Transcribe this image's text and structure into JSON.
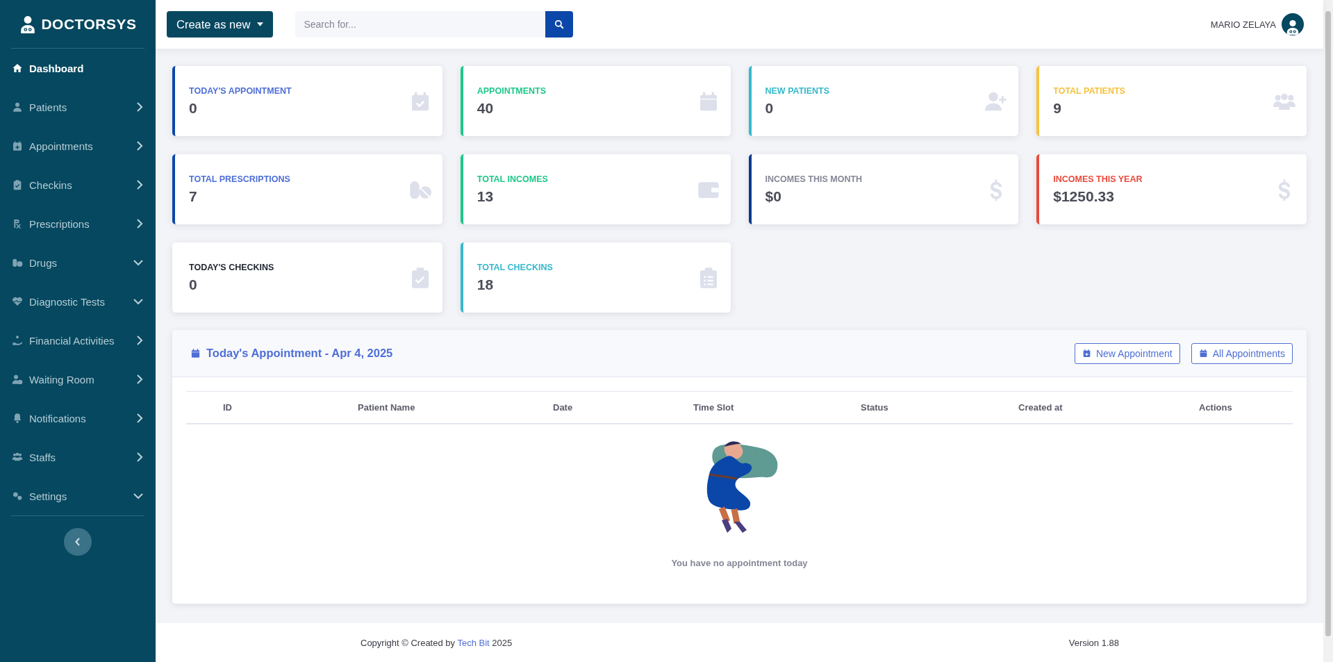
{
  "sidebar": {
    "brand": "DOCTORSYS",
    "items": [
      {
        "label": "Dashboard",
        "kind": "link",
        "selected": true
      },
      {
        "label": "Patients",
        "kind": "submenu",
        "selected": false
      },
      {
        "label": "Appointments",
        "kind": "submenu",
        "selected": false
      },
      {
        "label": "Checkins",
        "kind": "submenu",
        "selected": false
      },
      {
        "label": "Prescriptions",
        "kind": "submenu",
        "selected": false
      },
      {
        "label": "Drugs",
        "kind": "dropdown",
        "selected": false
      },
      {
        "label": "Diagnostic Tests",
        "kind": "dropdown",
        "selected": false
      },
      {
        "label": "Financial Activities",
        "kind": "submenu",
        "selected": false
      },
      {
        "label": "Waiting Room",
        "kind": "submenu",
        "selected": false
      },
      {
        "label": "Notifications",
        "kind": "submenu",
        "selected": false
      },
      {
        "label": "Staffs",
        "kind": "submenu",
        "selected": false
      },
      {
        "label": "Settings",
        "kind": "dropdown",
        "selected": false
      }
    ]
  },
  "topbar": {
    "create_button": "Create as new",
    "search": {
      "placeholder": "Search for..."
    },
    "user_name": "MARIO ZELAYA"
  },
  "stat_cards": [
    {
      "label": "TODAY'S APPOINTMENT",
      "value": "0",
      "color": "#4e6fd6",
      "stripe": {
        "color": "#0b47a8"
      }
    },
    {
      "label": "APPOINTMENTS",
      "value": "40",
      "color": "#1cc88a",
      "stripe": {
        "color": "#1cc88a"
      }
    },
    {
      "label": "NEW PATIENTS",
      "value": "0",
      "color": "#36b9cc",
      "stripe": {
        "color": "#36b9cc"
      }
    },
    {
      "label": "TOTAL PATIENTS",
      "value": "9",
      "color": "#f6c23e",
      "stripe": {
        "color": "#f6c23e"
      }
    },
    {
      "label": "TOTAL PRESCRIPTIONS",
      "value": "7",
      "color": "#4e6fd6",
      "stripe": {
        "color": "#0b47a8"
      }
    },
    {
      "label": "TOTAL INCOMES",
      "value": "13",
      "color": "#1cc88a",
      "stripe": {
        "color": "#1cc88a"
      }
    },
    {
      "label": "INCOMES THIS MONTH",
      "value": "$0",
      "color": "#858796",
      "stripe": {
        "color": "#0b3a8c"
      }
    },
    {
      "label": "INCOMES THIS YEAR",
      "value": "$1250.33",
      "color": "#e74a3b",
      "stripe": {
        "color": "#e74a3b"
      }
    },
    {
      "label": "TODAY'S CHECKINS",
      "value": "0",
      "color": "#1f2430",
      "stripe": {
        "color": "#ffffff"
      }
    },
    {
      "label": "TOTAL CHECKINS",
      "value": "18",
      "color": "#36b9cc",
      "stripe": {
        "color": "#36b9cc"
      }
    }
  ],
  "appointments_panel": {
    "title": "Today's Appointment - Apr 4, 2025",
    "buttons": [
      "New Appointment",
      "All Appointments"
    ],
    "table": {
      "columns": [
        "ID",
        "Patient Name",
        "Date",
        "Time Slot",
        "Status",
        "Created at",
        "Actions"
      ]
    },
    "empty_message": "You have no appointment today"
  },
  "footer": {
    "copyright_before": "Copyright © Created by",
    "link": "Tech Bit",
    "copyright_after": "2025",
    "version": "Version 1.88"
  }
}
